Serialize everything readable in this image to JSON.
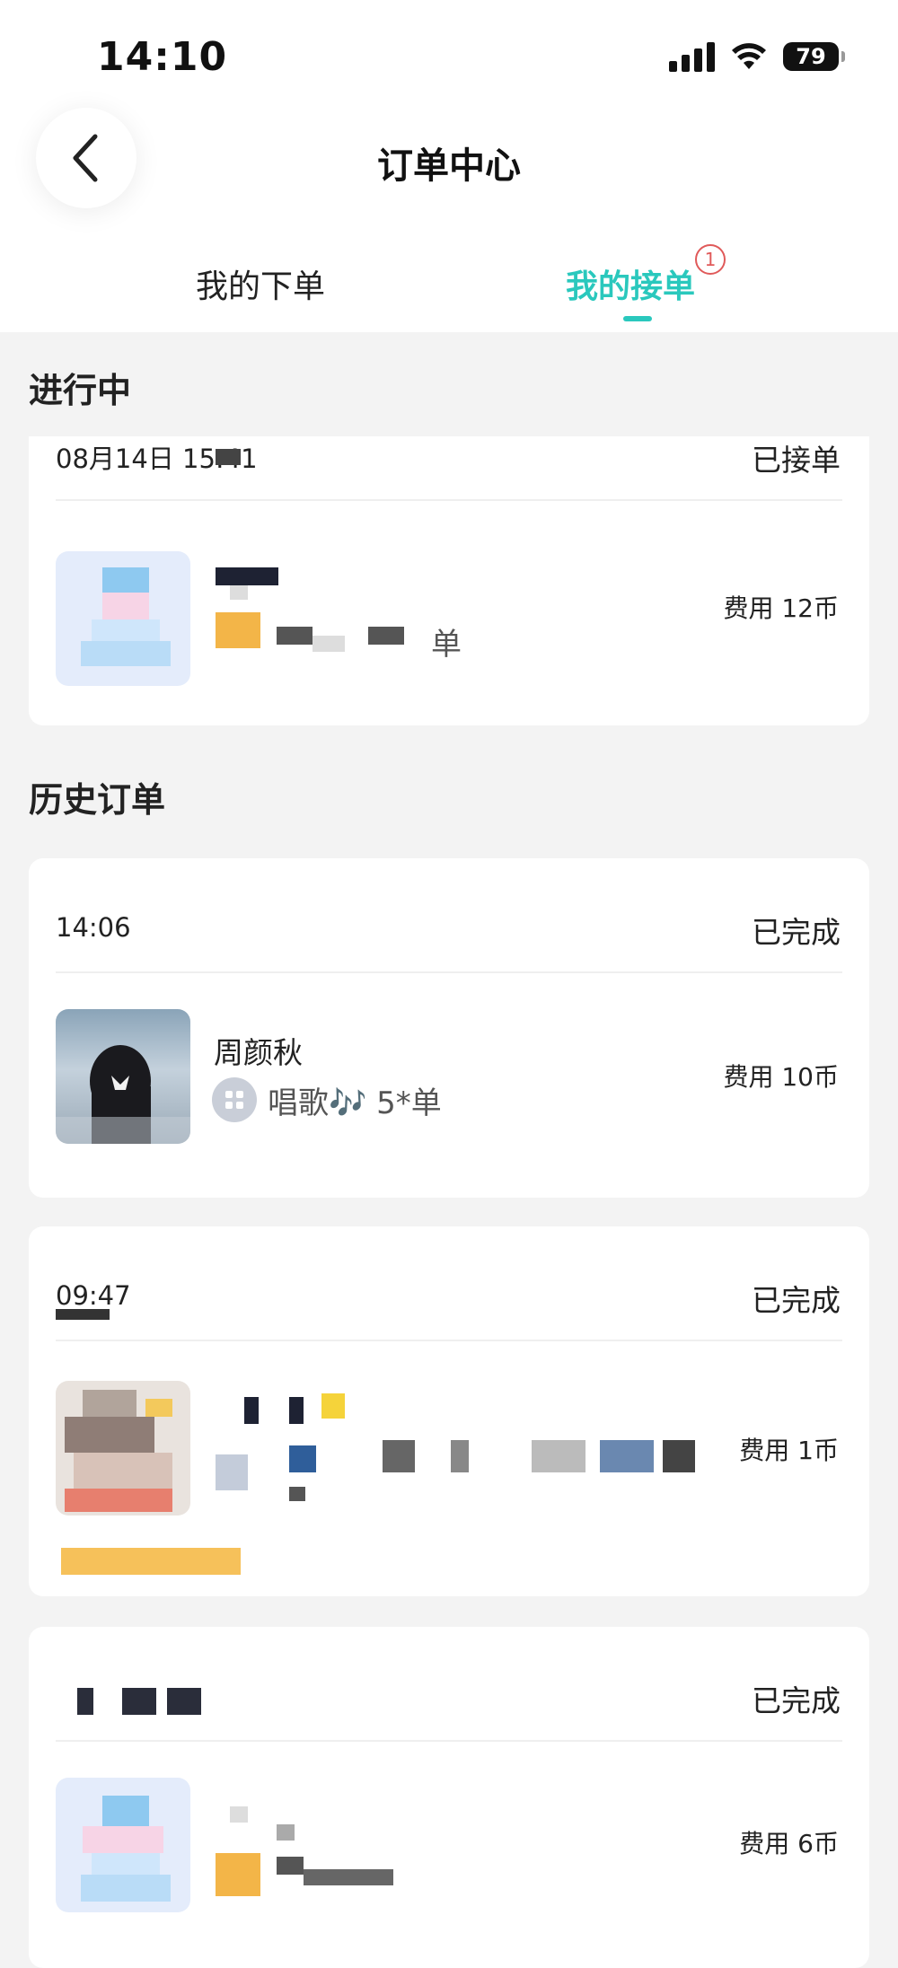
{
  "status_bar": {
    "time": "14:10",
    "battery": "79"
  },
  "header": {
    "title": "订单中心"
  },
  "tabs": [
    {
      "label": "我的下单",
      "active": false
    },
    {
      "label": "我的接单",
      "active": true,
      "badge": "1"
    }
  ],
  "colors": {
    "accent": "#2ac8bd",
    "badge": "#e05a5a",
    "background": "#f3f3f3"
  },
  "sections": {
    "in_progress": "进行中",
    "history": "历史订单"
  },
  "in_progress_order": {
    "time": "08月14日 15:41",
    "status": "已接单",
    "service_suffix": "单",
    "fee": "费用 12币"
  },
  "history_orders": [
    {
      "time": "14:06",
      "status": "已完成",
      "username": "周颜秋",
      "service": "唱歌🎶 5*单",
      "fee": "费用 10币"
    },
    {
      "time": "09:47",
      "status": "已完成",
      "fee": "费用 1币"
    },
    {
      "status": "已完成",
      "fee": "费用 6币"
    }
  ]
}
